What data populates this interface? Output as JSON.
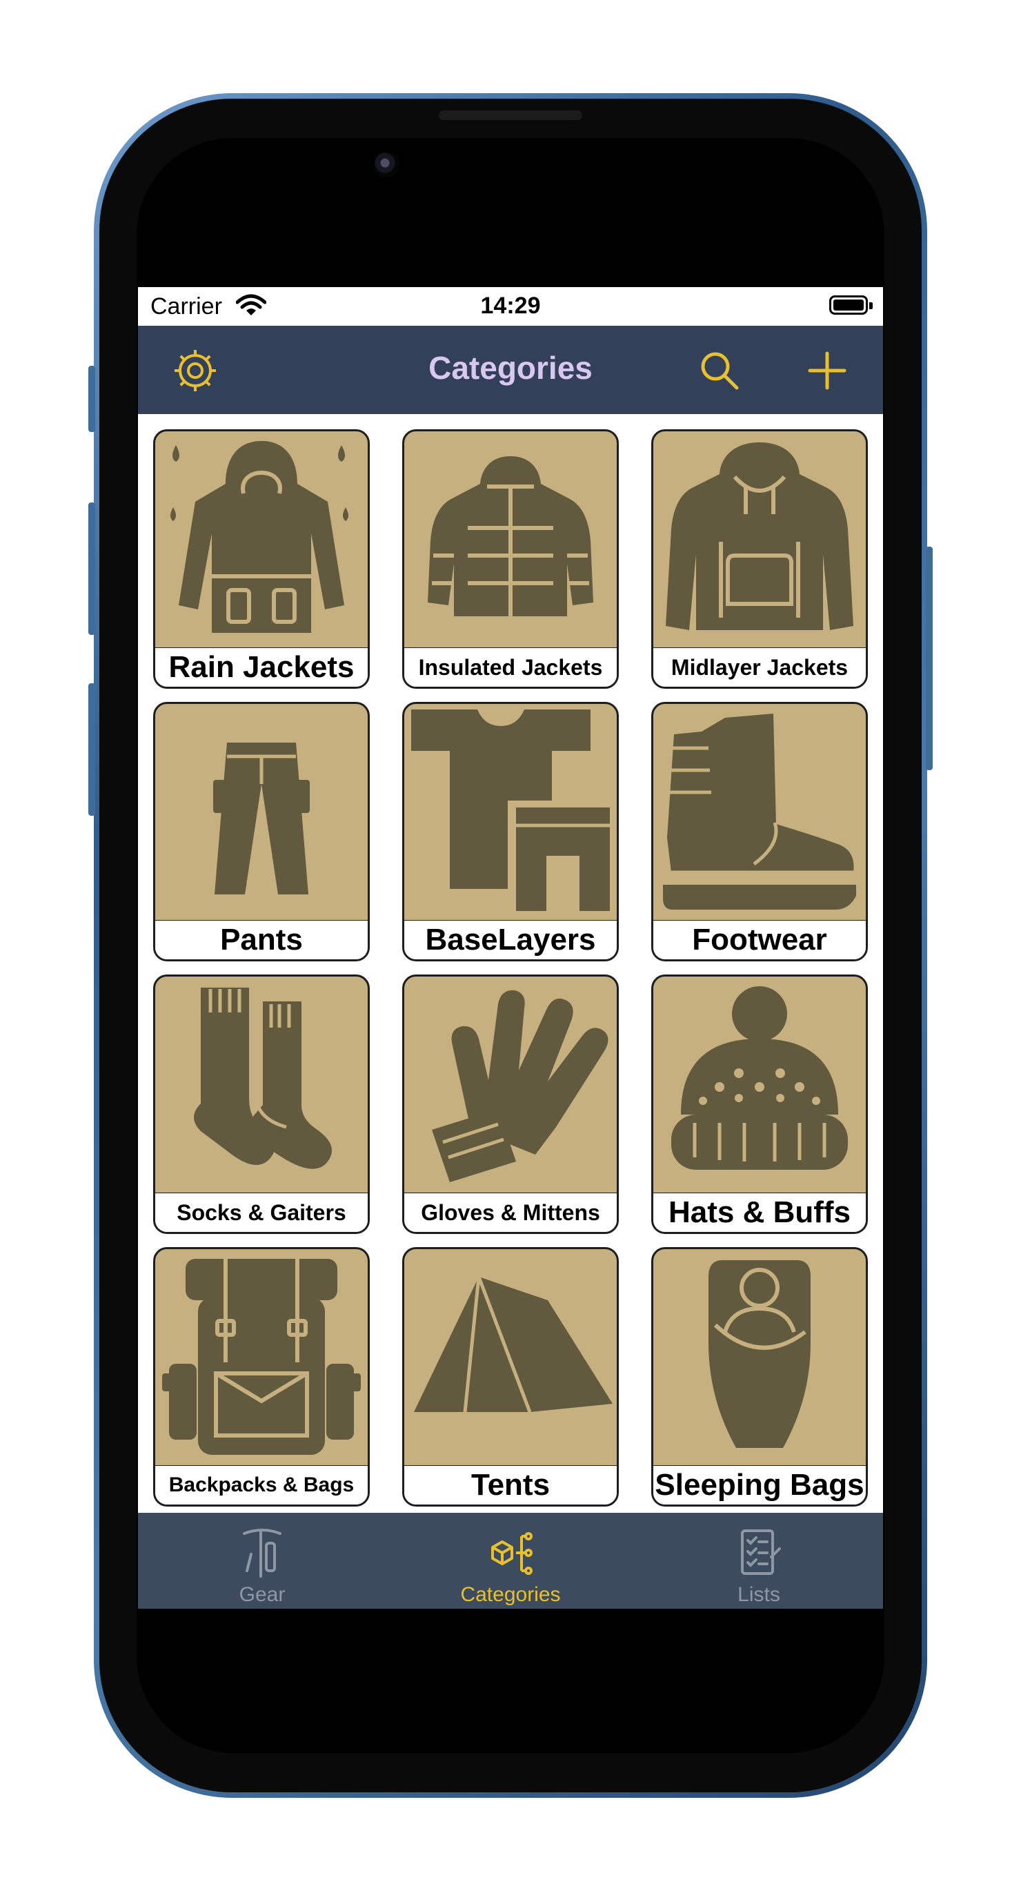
{
  "status": {
    "carrier": "Carrier",
    "time": "14:29"
  },
  "nav": {
    "title": "Categories",
    "left_icon": "gear-icon",
    "right_icons": [
      "search-icon",
      "plus-icon"
    ]
  },
  "colors": {
    "accent": "#e8bf2e",
    "navbar": "#33405a",
    "tabbar": "#3c4b5e",
    "tile_bg": "#c6b080",
    "icon": "#625a3e",
    "title": "#d8c8f0"
  },
  "categories": [
    {
      "label": "Rain Jackets",
      "icon": "rain-jacket-icon"
    },
    {
      "label": "Insulated Jackets",
      "icon": "insulated-jacket-icon"
    },
    {
      "label": "Midlayer Jackets",
      "icon": "hoodie-icon"
    },
    {
      "label": "Pants",
      "icon": "pants-icon"
    },
    {
      "label": "BaseLayers",
      "icon": "baselayer-icon"
    },
    {
      "label": "Footwear",
      "icon": "boot-icon"
    },
    {
      "label": "Socks & Gaiters",
      "icon": "socks-icon"
    },
    {
      "label": "Gloves & Mittens",
      "icon": "glove-icon"
    },
    {
      "label": "Hats & Buffs",
      "icon": "beanie-icon"
    },
    {
      "label": "Backpacks & Bags",
      "icon": "backpack-icon"
    },
    {
      "label": "Tents",
      "icon": "tent-icon"
    },
    {
      "label": "Sleeping Bags",
      "icon": "sleeping-bag-icon"
    }
  ],
  "tabs": [
    {
      "label": "Gear",
      "icon": "ice-axe-icon",
      "selected": false
    },
    {
      "label": "Categories",
      "icon": "category-tree-icon",
      "selected": true
    },
    {
      "label": "Lists",
      "icon": "checklist-icon",
      "selected": false
    }
  ]
}
